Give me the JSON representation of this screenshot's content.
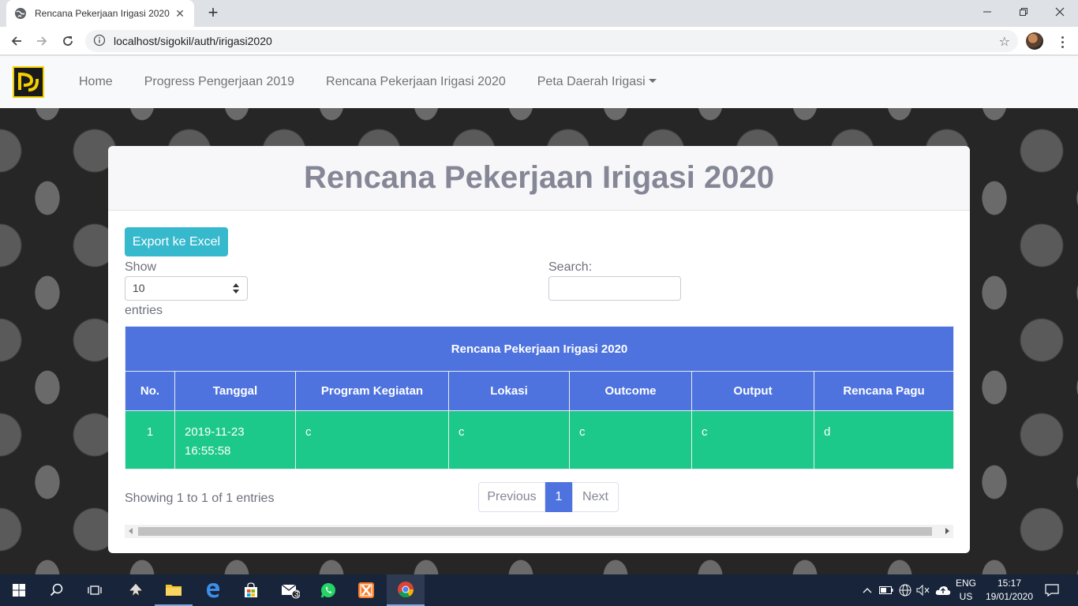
{
  "browser": {
    "tab_title": "Rencana Pekerjaan Irigasi 2020",
    "url": "localhost/sigokil/auth/irigasi2020"
  },
  "navbar": {
    "links": [
      "Home",
      "Progress Pengerjaan 2019",
      "Rencana Pekerjaan Irigasi 2020",
      "Peta Daerah Irigasi"
    ]
  },
  "card": {
    "title": "Rencana Pekerjaan Irigasi 2020",
    "export_label": "Export ke Excel",
    "show_label": "Show",
    "length_value": "10",
    "entries_label": "entries",
    "search_label": "Search:",
    "search_value": ""
  },
  "table": {
    "caption": "Rencana Pekerjaan Irigasi 2020",
    "columns": [
      "No.",
      "Tanggal",
      "Program Kegiatan",
      "Lokasi",
      "Outcome",
      "Output",
      "Rencana Pagu"
    ],
    "rows": [
      {
        "no": "1",
        "tanggal_date": "2019-11-23",
        "tanggal_time": "16:55:58",
        "program": "c",
        "lokasi": "c",
        "outcome": "c",
        "output": "c",
        "pagu": "d"
      }
    ]
  },
  "footer": {
    "info": "Showing 1 to 1 of 1 entries",
    "prev_label": "Previous",
    "current_page": "1",
    "next_label": "Next"
  },
  "taskbar": {
    "mail_badge": "3",
    "lang_line1": "ENG",
    "lang_line2": "US",
    "time": "15:17",
    "date": "19/01/2020"
  },
  "colors": {
    "primary": "#4e73df",
    "success": "#1cc88a",
    "info": "#36b9cc",
    "title_gray": "#858796"
  }
}
